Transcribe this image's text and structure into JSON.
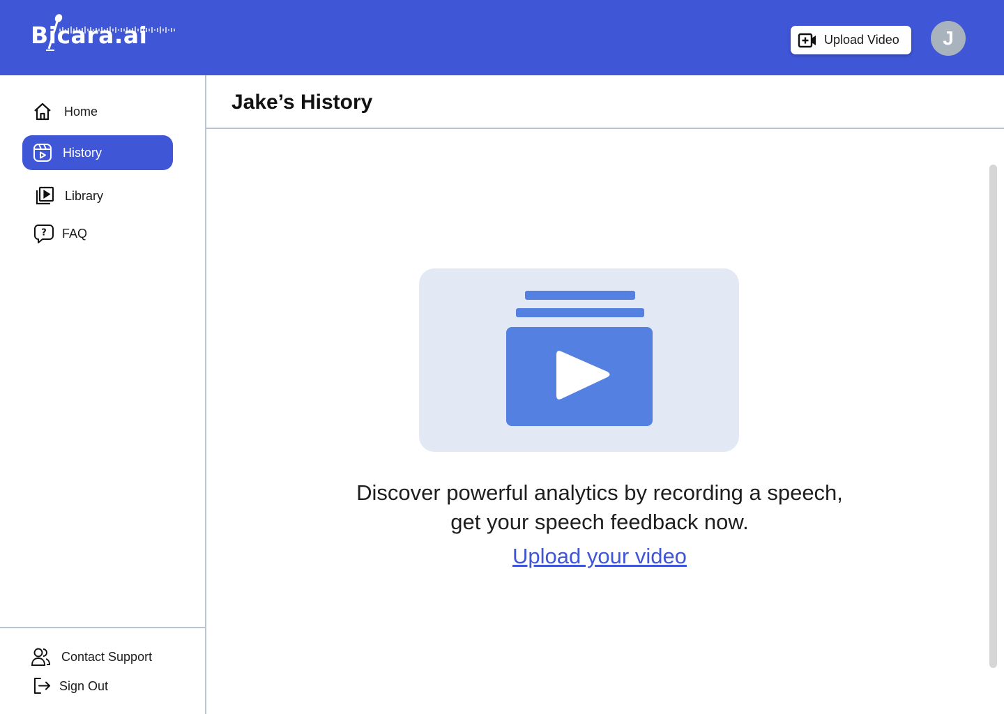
{
  "header": {
    "logo_text": "Bicara.ai",
    "upload_button_label": "Upload Video",
    "avatar_initial": "J",
    "brand_color": "#3f56d6"
  },
  "sidebar": {
    "items": [
      {
        "label": "Home",
        "icon": "home-icon",
        "active": false
      },
      {
        "label": "History",
        "icon": "history-icon",
        "active": true
      },
      {
        "label": "Library",
        "icon": "library-icon",
        "active": false
      },
      {
        "label": "FAQ",
        "icon": "faq-icon",
        "active": false
      }
    ],
    "bottom_items": [
      {
        "label": "Contact Support",
        "icon": "contact-support-icon"
      },
      {
        "label": "Sign Out",
        "icon": "sign-out-icon"
      }
    ]
  },
  "main": {
    "title": "Jake’s History",
    "empty_state": {
      "line1": "Discover powerful analytics by recording a speech,",
      "line2": "get your speech feedback now.",
      "link_label": "Upload your video",
      "illustration_icon": "video-stack-icon"
    }
  }
}
